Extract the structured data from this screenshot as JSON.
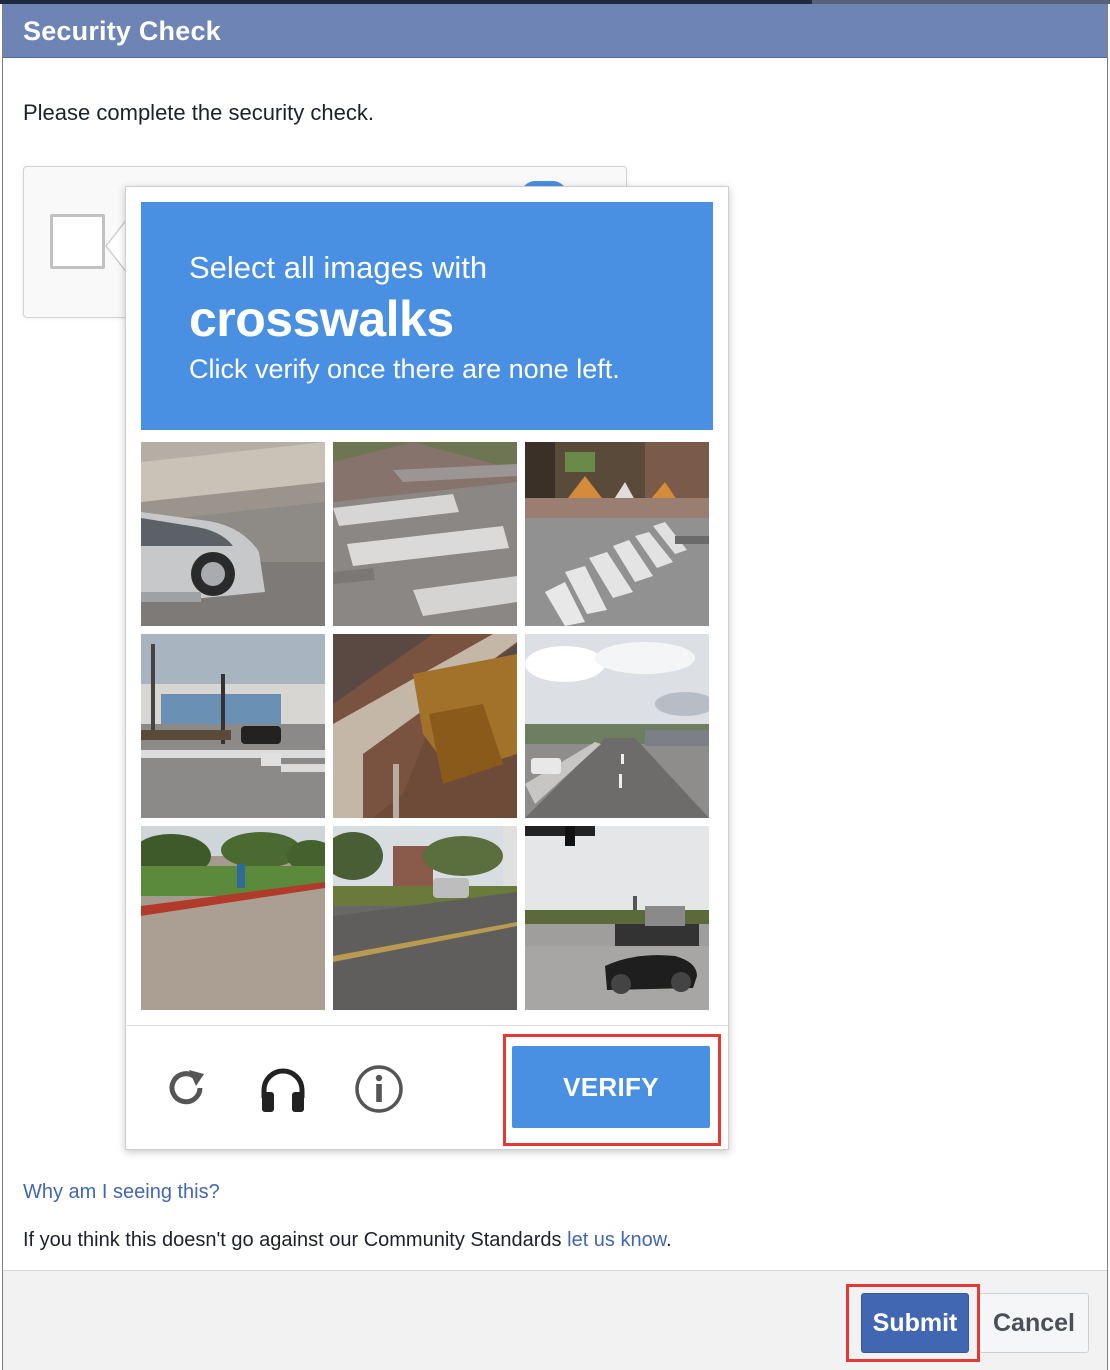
{
  "dialog": {
    "title": "Security Check",
    "intro": "Please complete the security check."
  },
  "captcha": {
    "prompt_line1": "Select all images with",
    "keyword": "crosswalks",
    "prompt_line2": "Click verify once there are none left.",
    "tiles": [
      {
        "row": 1,
        "col": 1,
        "scene": "silver car on road near concrete wall"
      },
      {
        "row": 1,
        "col": 2,
        "scene": "crosswalk stripes on road"
      },
      {
        "row": 1,
        "col": 3,
        "scene": "crosswalk near construction barriers"
      },
      {
        "row": 2,
        "col": 1,
        "scene": "intersection with crosswalk and traffic lights"
      },
      {
        "row": 2,
        "col": 2,
        "scene": "roof eave and tree"
      },
      {
        "row": 2,
        "col": 3,
        "scene": "highway with cloudy sky"
      },
      {
        "row": 3,
        "col": 1,
        "scene": "parking lot with trees"
      },
      {
        "row": 3,
        "col": 2,
        "scene": "street with car and buildings"
      },
      {
        "row": 3,
        "col": 3,
        "scene": "intersection with black car and truck"
      }
    ],
    "icons": [
      "reload-icon",
      "headphones-icon",
      "info-icon"
    ],
    "verify_label": "VERIFY",
    "colors": {
      "accent": "#4a90e2",
      "highlight": "#e53935"
    }
  },
  "links": {
    "why": "Why am I seeing this?",
    "standards_text": "If you think this doesn't go against our Community Standards ",
    "standards_link": "let us know",
    "standards_end": "."
  },
  "buttons": {
    "submit": "Submit",
    "cancel": "Cancel"
  },
  "colors": {
    "titlebar": "#6d84b4",
    "link": "#4267b2",
    "submit": "#4267b2"
  }
}
